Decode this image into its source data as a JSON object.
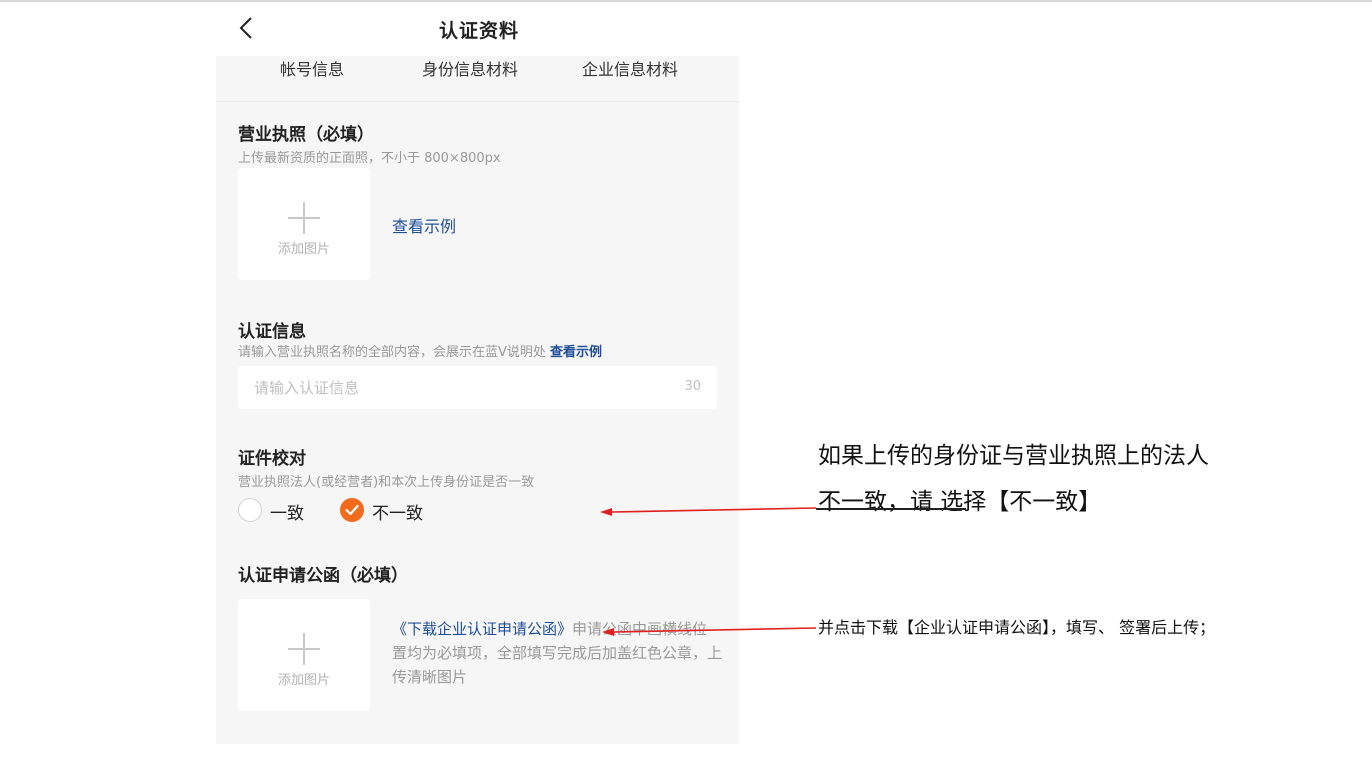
{
  "header": {
    "title": "认证资料",
    "back_icon": "chevron-left-icon"
  },
  "tabs": [
    {
      "label": "帐号信息"
    },
    {
      "label": "身份信息材料"
    },
    {
      "label": "企业信息材料"
    }
  ],
  "business_license": {
    "title": "营业执照（必填）",
    "subtitle": "上传最新资质的正面照，不小于 800×800px",
    "upload_label": "添加图片",
    "upload_icon": "plus-icon",
    "example_link": "查看示例"
  },
  "cert_info": {
    "title": "认证信息",
    "subtitle": "请输入营业执照名称的全部内容，会展示在蓝V说明处",
    "example_link": "查看示例",
    "input_placeholder": "请输入认证信息",
    "input_value": "",
    "counter": "30"
  },
  "verify": {
    "title": "证件校对",
    "subtitle": "营业执照法人(或经营者)和本次上传身份证是否一致",
    "options": [
      {
        "label": "一致",
        "selected": false
      },
      {
        "label": "不一致",
        "selected": true
      }
    ]
  },
  "application_letter": {
    "title": "认证申请公函（必填）",
    "upload_label": "添加图片",
    "upload_icon": "plus-icon",
    "download_link": "《下载企业认证申请公函》",
    "description": "申请公函中画横线位置均为必填项，全部填写完成后加盖红色公章，上传清晰图片"
  },
  "annotations": {
    "note1_line1": "如果上传的身份证与营业执照上的法人",
    "note1_line2": "不一致，请  选择【不一致】",
    "note2": "并点击下载【企业认证申请公函】，填写、 签署后上传；"
  },
  "colors": {
    "accent_orange": "#f26b1d",
    "link_blue": "#1f4e9a",
    "arrow_red": "#e02020",
    "panel_bg": "#f6f6f6"
  }
}
